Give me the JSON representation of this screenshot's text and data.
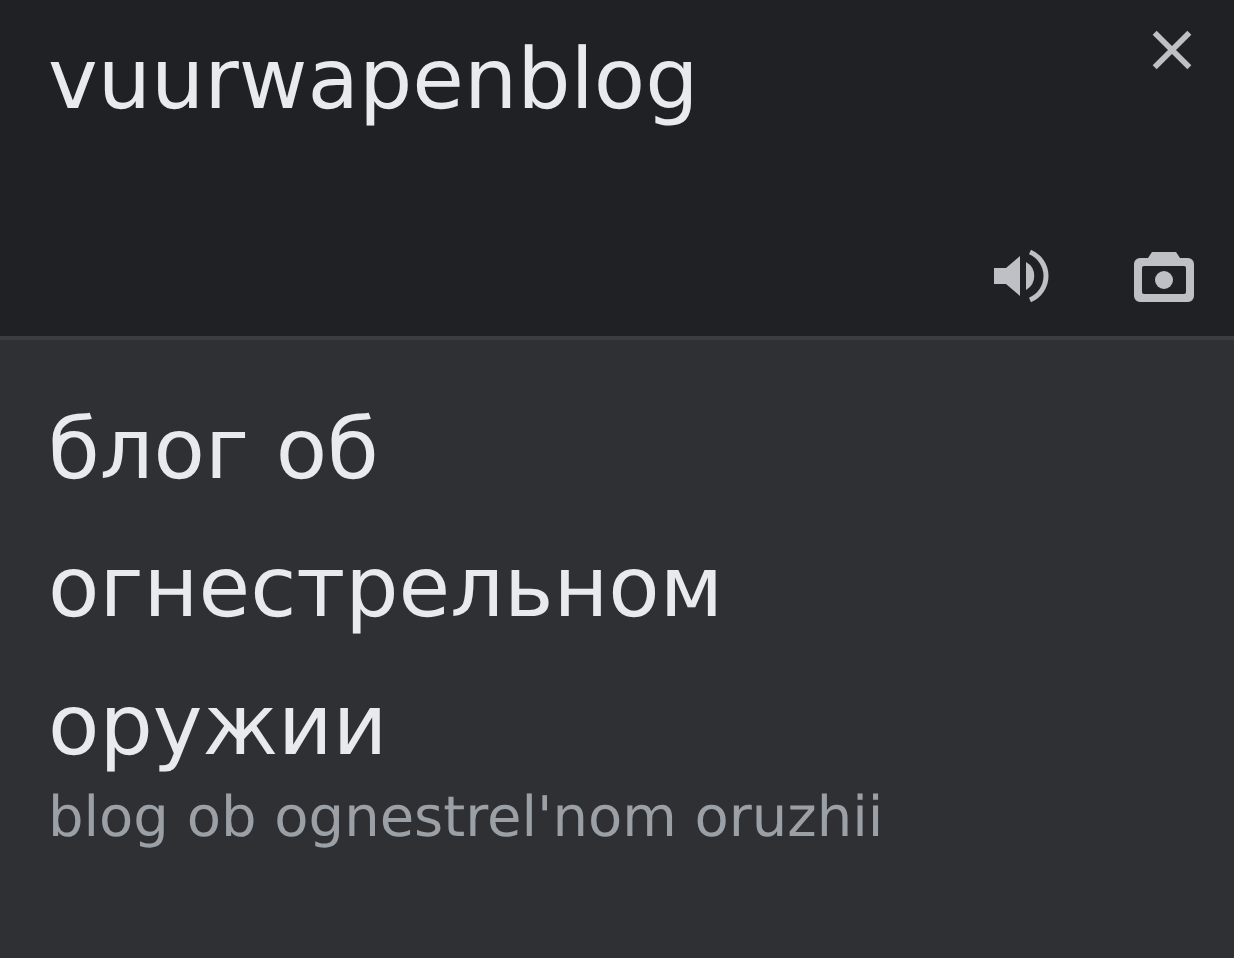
{
  "source": {
    "text": "vuurwapenblog"
  },
  "translation": {
    "text": "блог об огнестрельном оружии",
    "transliteration": "blog ob ognestrel'nom oruzhii"
  }
}
